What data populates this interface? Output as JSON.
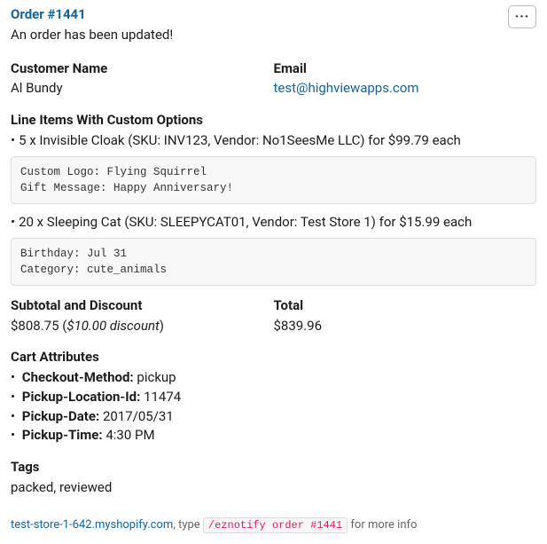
{
  "header": {
    "title": "Order #1441",
    "subtitle": "An order has been updated!",
    "more_icon": "···"
  },
  "customer": {
    "name_label": "Customer Name",
    "name_value": "Al Bundy",
    "email_label": "Email",
    "email_value": "test@highviewapps.com"
  },
  "line_items_label": "Line Items With Custom Options",
  "line_items": [
    {
      "text": "5 x Invisible Cloak (SKU: INV123, Vendor: No1SeesMe LLC) for $99.79 each",
      "options": "Custom Logo: Flying Squirrel\nGift Message: Happy Anniversary!"
    },
    {
      "text": "20 x Sleeping Cat (SKU: SLEEPYCAT01, Vendor: Test Store 1) for $15.99 each",
      "options": "Birthday: Jul 31\nCategory: cute_animals"
    }
  ],
  "subtotal": {
    "label": "Subtotal and Discount",
    "amount": "$808.75 (",
    "discount": "$10.00 discount",
    "close": ")"
  },
  "total": {
    "label": "Total",
    "value": "$839.96"
  },
  "cart_attrs_label": "Cart Attributes",
  "cart_attrs": [
    {
      "key": "Checkout-Method:",
      "value": "pickup"
    },
    {
      "key": "Pickup-Location-Id:",
      "value": "11474"
    },
    {
      "key": "Pickup-Date:",
      "value": "2017/05/31"
    },
    {
      "key": "Pickup-Time:",
      "value": "4:30 PM"
    }
  ],
  "tags": {
    "label": "Tags",
    "value": "packed, reviewed"
  },
  "footer": {
    "store": "test-store-1-642.myshopify.com",
    "text1": ", type ",
    "command": "/eznotify order #1441",
    "text2": " for more info"
  }
}
